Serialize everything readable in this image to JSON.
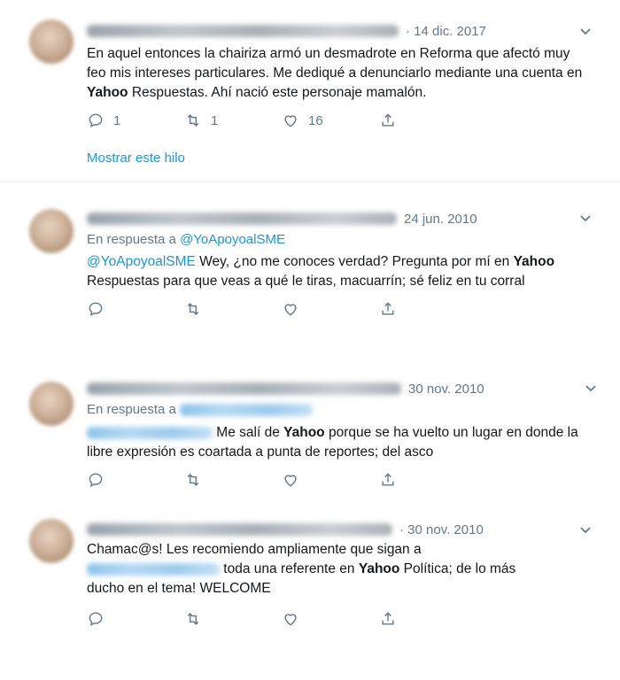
{
  "tweets": [
    {
      "date": "· 14 dic. 2017",
      "reply_prefix": "",
      "reply_handle": "",
      "body_html": "",
      "segments": [
        {
          "t": "En aquel entonces la chairiza armó un desmadrote en Reforma que afectó muy feo mis intereses particulares. Me dediqué a denunciarlo mediante una cuenta en "
        },
        {
          "b": "Yahoo"
        },
        {
          "t": " Respuestas. Ahí nació este personaje mamalón."
        }
      ],
      "counts": {
        "reply": "1",
        "retweet": "1",
        "like": "16"
      },
      "thread_link": "Mostrar este hilo"
    },
    {
      "date": "24 jun. 2010",
      "reply_prefix": "En respuesta a",
      "reply_handle": "@YoApoyoalSME",
      "mention": "@YoApoyoalSME",
      "text1": " Wey, ¿no me conoces verdad? Pregunta por mí en ",
      "bold": "Yahoo",
      "text2": " Respuestas para que veas a qué le tiras, macuarrín; sé feliz en tu corral"
    },
    {
      "date": "30 nov. 2010",
      "reply_prefix": "En respuesta a",
      "text1": " Me salí de ",
      "bold": "Yahoo",
      "text2": " porque se ha vuelto un lugar en donde la libre expresión es coartada a punta de reportes; del asco"
    },
    {
      "date": "· 30 nov. 2010",
      "text1": "Chamac@s! Les recomiendo ampliamente que sigan a ",
      "text2": " toda una referente en ",
      "bold": "Yahoo",
      "text3": " Política; de lo más ducho en el tema! WELCOME"
    }
  ],
  "icons": {
    "reply": "reply-icon",
    "retweet": "retweet-icon",
    "like": "heart-icon",
    "share": "share-icon",
    "menu": "chevron-down-icon"
  },
  "colors": {
    "link": "#1b95e0",
    "muted": "#657786",
    "text": "#14171a"
  }
}
